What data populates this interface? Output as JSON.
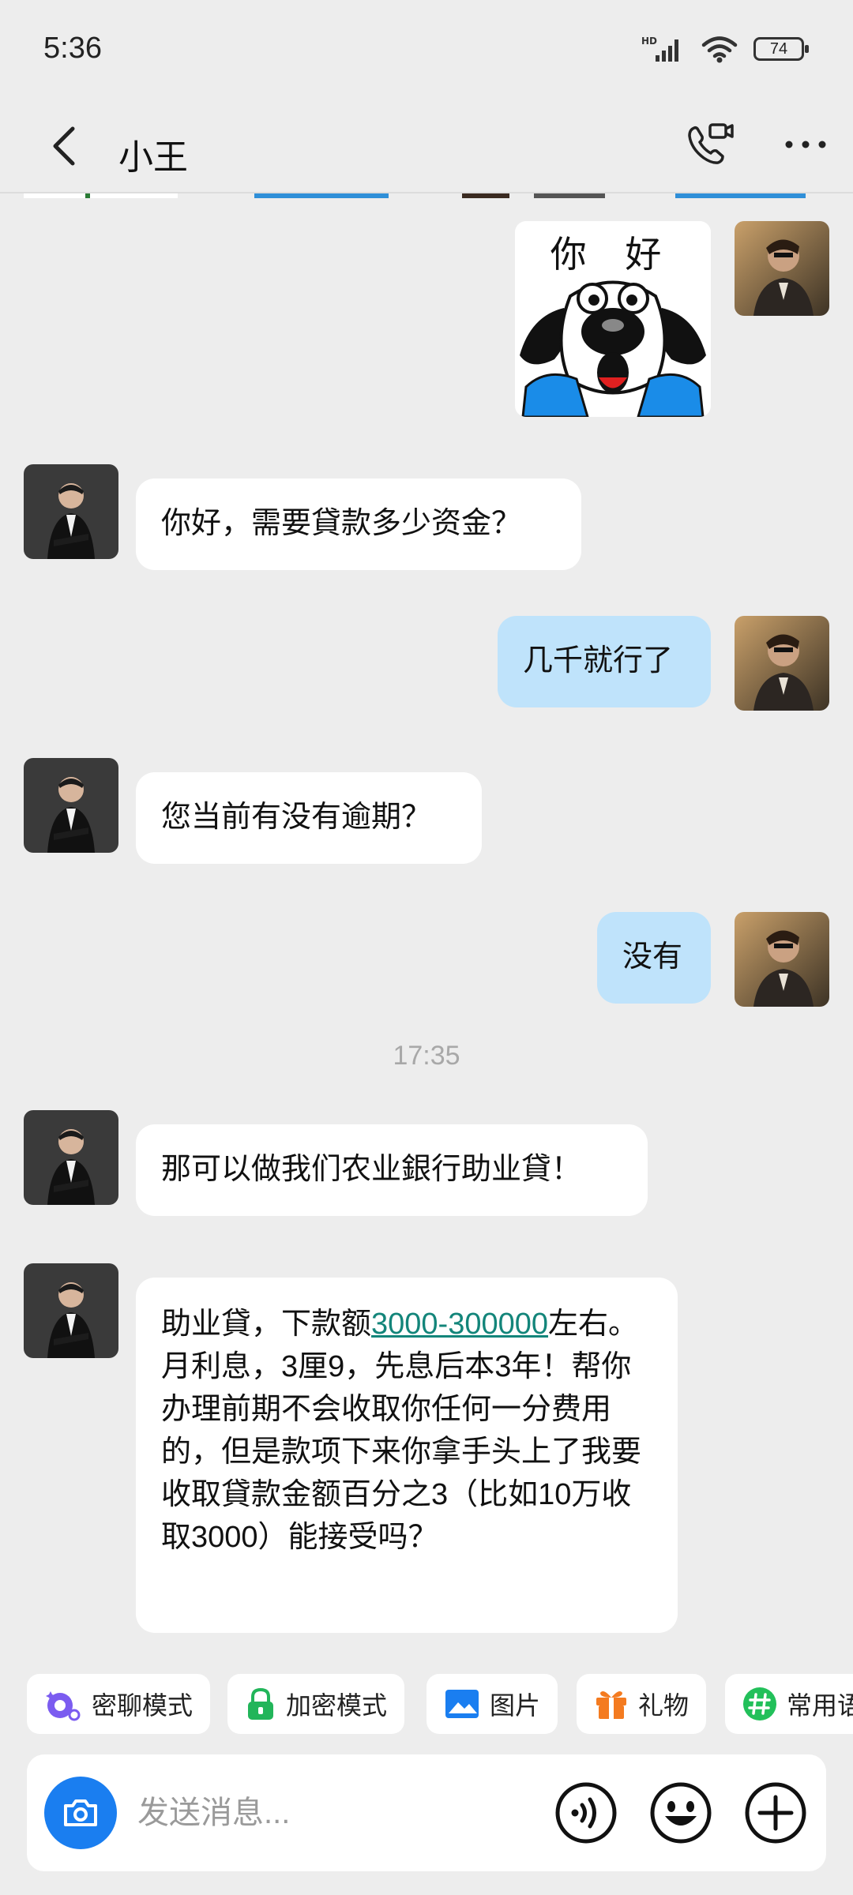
{
  "status_bar": {
    "time": "5:36",
    "network_label": "HD",
    "battery": "74"
  },
  "header": {
    "title": "小王"
  },
  "sticker": {
    "text": "你 好"
  },
  "messages": [
    {
      "id": "m1",
      "direction": "in",
      "text": "你好，需要貸款多少资金？"
    },
    {
      "id": "m2",
      "direction": "out",
      "text": "几千就行了"
    },
    {
      "id": "m3",
      "direction": "in",
      "text": "您当前有没有逾期？"
    },
    {
      "id": "m4",
      "direction": "out",
      "text": "没有"
    },
    {
      "id": "m5",
      "direction": "in",
      "text": "那可以做我们农业銀行助业貸！"
    },
    {
      "id": "m6",
      "direction": "in",
      "text_before_link": "助业貸，下款额",
      "link": "3000-300000",
      "text_after_link": "左右。月利息，3厘9，先息后本3年！帮你办理前期不会收取你任何一分费用的，但是款项下来你拿手头上了我要收取貸款金额百分之3（比如10万收取3000）能接受吗？"
    }
  ],
  "timestamp": "17:35",
  "quick_actions": [
    {
      "label": "密聊模式",
      "icon": "secret-chat-icon"
    },
    {
      "label": "加密模式",
      "icon": "lock-icon"
    },
    {
      "label": "图片",
      "icon": "image-icon"
    },
    {
      "label": "礼物",
      "icon": "gift-icon"
    },
    {
      "label": "常用语",
      "icon": "hashtag-icon"
    }
  ],
  "input": {
    "placeholder": "发送消息..."
  },
  "colors": {
    "background": "#ededed",
    "outgoing_bubble": "#bfe3fb",
    "incoming_bubble": "#ffffff",
    "link": "#13857a",
    "camera_button": "#1a7ef0"
  }
}
